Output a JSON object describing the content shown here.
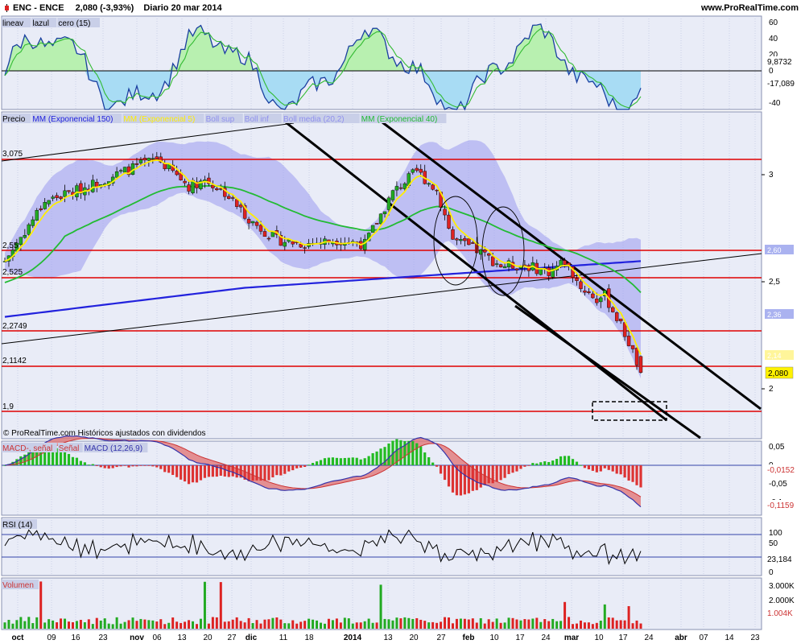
{
  "header": {
    "ticker": "ENC - ENCE",
    "price_change": "2,080 (-3,93%)",
    "period_date": "Diario  20 mar 2014",
    "site": "www.ProRealTime.com"
  },
  "colors": {
    "panel_bg": "#e9ecf7",
    "grid": "#b8c0dc",
    "resistance_lines": "#e00000",
    "channel_lines": "#000000",
    "ema150": "#2222dd",
    "ema5": "#ffee00",
    "ema40": "#22bb33",
    "bollinger_band": "#9a9af0",
    "candle_up": "#22aa22",
    "candle_down": "#dd2222",
    "macd_hist_pos": "#22bb22",
    "macd_hist_neg": "#dd3333",
    "lazul_fill_pos": "#b8f0b0",
    "lazul_fill_neg": "#a8dcf4"
  },
  "panels": {
    "lazul": {
      "legend": [
        "lineav",
        "lazul",
        "cero (15)"
      ],
      "ticks": [
        "60",
        "40",
        "20",
        "0",
        "-20",
        "-40"
      ],
      "value_tags": [
        "9,8732",
        "-17,089"
      ]
    },
    "price": {
      "legend": [
        "Precio",
        "MM (Exponencial 150)",
        "MM (Exponencial 5)",
        "Boll sup",
        "Boll inf",
        "Boll media (20,2)",
        "MM (Exponencial 40)"
      ],
      "ticks": [
        "3",
        "2,5",
        "2"
      ],
      "level_labels": [
        "3,075",
        "2,55",
        "2,525",
        "2,2749",
        "2,1142",
        "1,9"
      ],
      "right_tags": [
        "2,60",
        "2,36",
        "2,14"
      ],
      "last_price": "2,080",
      "copyright": "© ProRealTime.com  Históricos ajustados con dividendos"
    },
    "macd": {
      "legend": [
        "MACD-, señal",
        "Señal",
        "MACD (12,26,9)"
      ],
      "ticks": [
        "0,05",
        "0",
        "-0,05",
        "-0,1"
      ],
      "value_tags": [
        "-0,0152",
        "-0,1159"
      ]
    },
    "rsi": {
      "legend": [
        "RSI (14)"
      ],
      "ticks": [
        "100",
        "50",
        "0"
      ],
      "value_tag": "23,184"
    },
    "volume": {
      "legend": [
        "Volumen"
      ],
      "ticks": [
        "3.000K",
        "2.000K",
        "1.000K"
      ],
      "value_tag": "1.004K"
    }
  },
  "x_axis": [
    "oct",
    "09",
    "16",
    "23",
    "nov",
    "06",
    "13",
    "20",
    "27",
    "dic",
    "11",
    "18",
    "2014",
    "13",
    "20",
    "27",
    "feb",
    "10",
    "17",
    "24",
    "mar",
    "10",
    "17",
    "24",
    "abr",
    "07",
    "14",
    "23"
  ]
}
